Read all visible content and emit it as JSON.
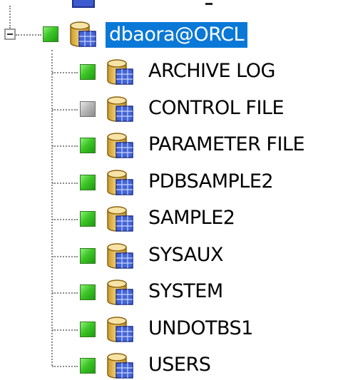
{
  "tree": {
    "root": {
      "label": "dbaora@ORCL",
      "status": "online",
      "icon": "database-icon",
      "selected": true,
      "expanded": true
    },
    "children": [
      {
        "label": "ARCHIVE LOG",
        "status": "online",
        "icon": "database-icon"
      },
      {
        "label": "CONTROL FILE",
        "status": "offline",
        "icon": "database-icon"
      },
      {
        "label": "PARAMETER FILE",
        "status": "online",
        "icon": "database-icon"
      },
      {
        "label": "PDBSAMPLE2",
        "status": "online",
        "icon": "database-icon"
      },
      {
        "label": "SAMPLE2",
        "status": "online",
        "icon": "database-icon"
      },
      {
        "label": "SYSAUX",
        "status": "online",
        "icon": "database-icon"
      },
      {
        "label": "SYSTEM",
        "status": "online",
        "icon": "database-icon"
      },
      {
        "label": "UNDOTBS1",
        "status": "online",
        "icon": "database-icon"
      },
      {
        "label": "USERS",
        "status": "online",
        "icon": "database-icon"
      }
    ]
  },
  "colors": {
    "selection": "#0a78d7",
    "online": "#3ec628",
    "offline": "#b8b8b8",
    "connector": "#8a8a8a"
  }
}
